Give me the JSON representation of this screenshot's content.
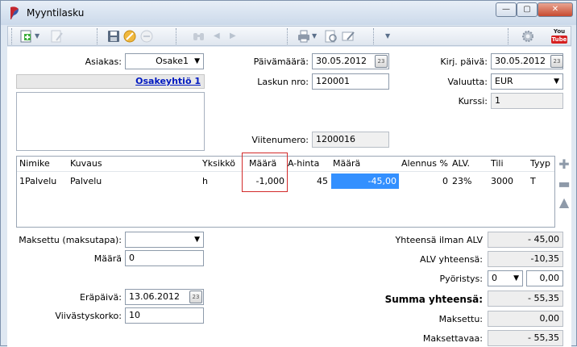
{
  "window": {
    "title": "Myyntilasku",
    "minimize_glyph": "—",
    "maximize_glyph": "▢",
    "close_glyph": "✕"
  },
  "toolbar": {
    "icons": [
      "add-icon",
      "edit-icon",
      "save-icon",
      "cancel-icon",
      "remove-icon",
      "find-icon",
      "prev-icon",
      "next-icon",
      "print-icon",
      "preview-icon",
      "email-icon",
      "more-icon",
      "settings-icon",
      "youtube-icon"
    ],
    "youtube_top": "You",
    "youtube_bottom": "Tube"
  },
  "form": {
    "customer_label": "Asiakas:",
    "customer_value": "Osake1",
    "customer_name": "Osakeyhtiö 1",
    "date_label": "Päivämäärä:",
    "date_value": "30.05.2012",
    "invoice_no_label": "Laskun nro:",
    "invoice_no_value": "120001",
    "reference_label": "Viitenumero:",
    "reference_value": "1200016",
    "booking_date_label": "Kirj. päivä:",
    "booking_date_value": "30.05.2012",
    "currency_label": "Valuutta:",
    "currency_value": "EUR",
    "rate_label": "Kurssi:",
    "rate_value": "1",
    "calendar_glyph": "23"
  },
  "grid": {
    "columns": [
      "Nimike",
      "Kuvaus",
      "Yksikkö",
      "Määrä",
      "A-hinta",
      "Määrä",
      "Alennus %",
      "ALV.",
      "Tili",
      "Tyyp"
    ],
    "rows": [
      [
        "1Palvelu",
        "Palvelu",
        "h",
        "-1,000",
        "45",
        "-45,00",
        "0",
        "23%",
        "3000",
        "T"
      ]
    ]
  },
  "payment": {
    "paid_method_label": "Maksettu (maksutapa):",
    "paid_method_value": "",
    "amount_label": "Määrä",
    "amount_value": "0",
    "due_label": "Eräpäivä:",
    "due_value": "13.06.2012",
    "interest_label": "Viivästyskorko:",
    "interest_value": "10"
  },
  "summary": {
    "excl_vat_label": "Yhteensä ilman ALV",
    "excl_vat_value": "- 45,00",
    "vat_total_label": "ALV yhteensä:",
    "vat_total_value": "-10,35",
    "rounding_label": "Pyöristys:",
    "rounding_select": "0",
    "rounding_value": "0,00",
    "total_label": "Summa yhteensä:",
    "total_value": "- 55,35",
    "paid_label": "Maksettu:",
    "paid_value": "0,00",
    "due_amount_label": "Maksettavaa:",
    "due_amount_value": "- 55,35"
  },
  "colors": {
    "selected_cell": "#3390ff",
    "highlight_border": "#d22a2a",
    "link": "#0019c0"
  }
}
